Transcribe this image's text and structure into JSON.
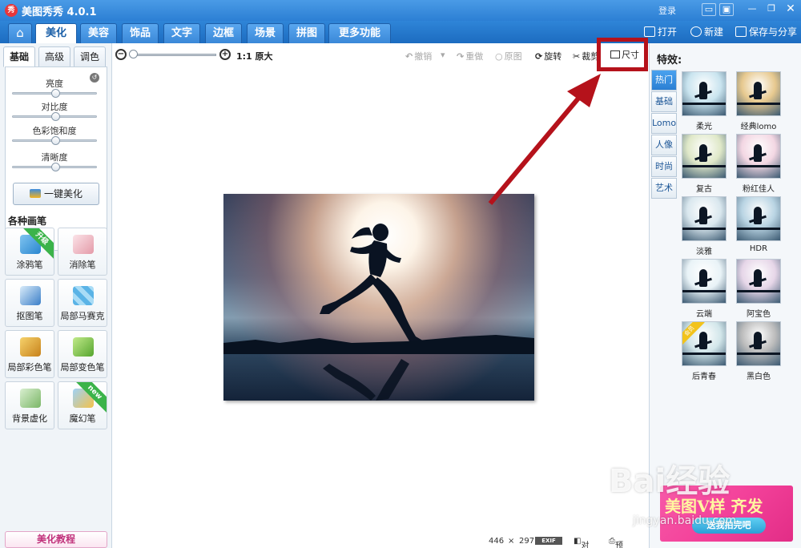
{
  "app": {
    "title": "美图秀秀 4.0.1",
    "logo_text": "秀",
    "login": "登录"
  },
  "tabs": [
    "美化",
    "美容",
    "饰品",
    "文字",
    "边框",
    "场景",
    "拼图",
    "更多功能 ▾"
  ],
  "tab_actions": {
    "open": "打开",
    "new": "新建",
    "save_share": "保存与分享"
  },
  "left": {
    "subtabs": [
      "基础",
      "高级",
      "调色"
    ],
    "sliders": [
      {
        "label": "亮度",
        "value": 0.5
      },
      {
        "label": "对比度",
        "value": 0.5
      },
      {
        "label": "色彩饱和度",
        "value": 0.5
      },
      {
        "label": "清晰度",
        "value": 0.5
      }
    ],
    "onekey": "一键美化",
    "pens_title": "各种画笔",
    "pens": [
      {
        "label": "涂鸦笔",
        "badge": "升级"
      },
      {
        "label": "消除笔",
        "badge": ""
      },
      {
        "label": "抠图笔",
        "badge": ""
      },
      {
        "label": "局部马赛克",
        "badge": ""
      },
      {
        "label": "局部彩色笔",
        "badge": ""
      },
      {
        "label": "局部变色笔",
        "badge": ""
      },
      {
        "label": "背景虚化",
        "badge": ""
      },
      {
        "label": "魔幻笔",
        "badge": "new"
      }
    ],
    "tutorial": "美化教程"
  },
  "toolbar": {
    "zoom_label": "1:1 原大",
    "undo": "撤销",
    "redo": "重做",
    "original": "原图",
    "rotate": "旋转",
    "crop": "裁剪",
    "size": "尺寸"
  },
  "status": {
    "width": "446",
    "times": "×",
    "height": "297",
    "exif": "EXIF",
    "compare": "对比",
    "preview": "预览"
  },
  "right": {
    "title": "特效:",
    "categories": [
      "热门",
      "基础",
      "Lomo",
      "人像",
      "时尚",
      "艺术"
    ],
    "effects": [
      {
        "label": "柔光",
        "tint": "#c9e4ef"
      },
      {
        "label": "经典lomo",
        "tint": "#e7c98f"
      },
      {
        "label": "复古",
        "tint": "#dfe8c8"
      },
      {
        "label": "粉红佳人",
        "tint": "#f3d7e3"
      },
      {
        "label": "淡雅",
        "tint": "#d9e7ee"
      },
      {
        "label": "HDR",
        "tint": "#b9d4e3"
      },
      {
        "label": "云端",
        "tint": "#e9f3f7"
      },
      {
        "label": "阿宝色",
        "tint": "#e6d6e8"
      },
      {
        "label": "后青春",
        "tint": "#d2e6ea",
        "badge": "会员"
      },
      {
        "label": "黑白色",
        "tint": "#bcbcbc"
      }
    ],
    "ad": {
      "title": "美图V样 齐发",
      "button": "送我拍完吧"
    }
  },
  "watermark": {
    "main": "Bai经验",
    "sub": "jingyan.baidu.com"
  }
}
